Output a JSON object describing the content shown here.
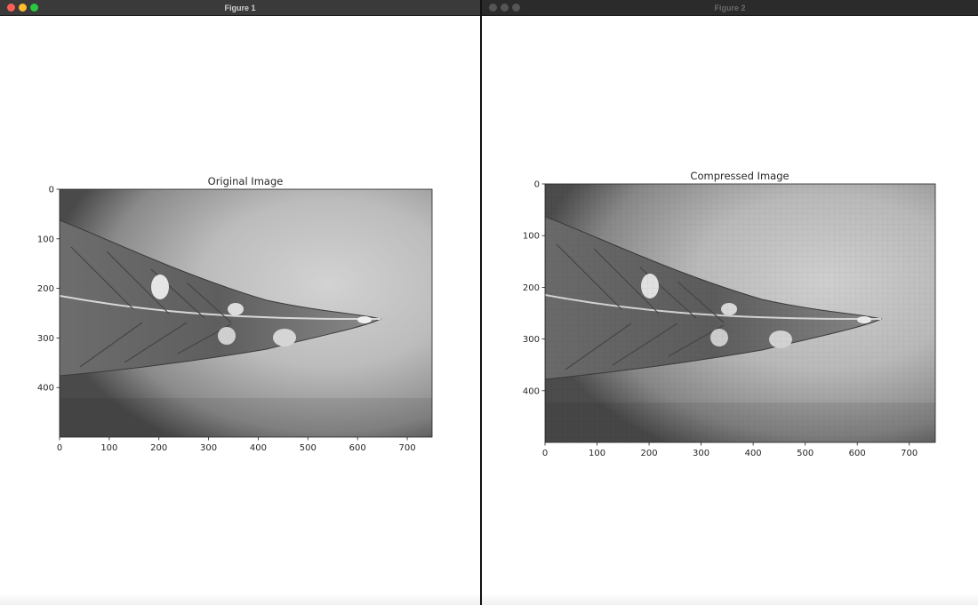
{
  "colors": {
    "close": "#ff5f57",
    "minimize": "#febc2e",
    "zoom": "#28c840",
    "inactive": "#555555"
  },
  "windows": [
    {
      "title": "Figure 1",
      "active": true,
      "plot": {
        "title": "Original Image",
        "xticks": [
          "0",
          "100",
          "200",
          "300",
          "400",
          "500",
          "600",
          "700"
        ],
        "yticks": [
          "0",
          "100",
          "200",
          "300",
          "400"
        ],
        "xlim": [
          0,
          750
        ],
        "ylim": [
          500,
          0
        ],
        "content": "grayscale-leaf-tip-photo",
        "compressed": false
      }
    },
    {
      "title": "Figure 2",
      "active": false,
      "plot": {
        "title": "Compressed Image",
        "xticks": [
          "0",
          "100",
          "200",
          "300",
          "400",
          "500",
          "600",
          "700"
        ],
        "yticks": [
          "0",
          "100",
          "200",
          "300",
          "400"
        ],
        "xlim": [
          0,
          750
        ],
        "ylim": [
          500,
          0
        ],
        "content": "grayscale-leaf-tip-photo",
        "compressed": true
      }
    }
  ]
}
